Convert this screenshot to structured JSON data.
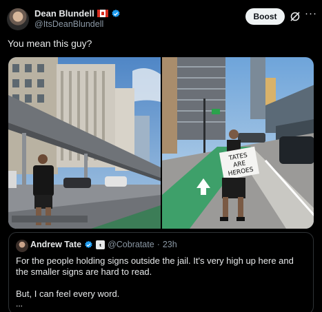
{
  "post": {
    "author": {
      "display_name": "Dean Blundell",
      "handle": "@ItsDeanBlundell",
      "flag_icon": "canada-flag-icon",
      "verified_color": "#1d9bf0"
    },
    "boost_label": "Boost",
    "more_label": "···",
    "text": "You mean this guy?"
  },
  "media": {
    "photo2_sign": [
      "TATES",
      "ARE",
      "HEROES"
    ]
  },
  "quote": {
    "author": {
      "display_name": "Andrew Tate",
      "handle": "@Cobratate",
      "affiliate_badge": "ₜ"
    },
    "separator": "·",
    "time": "23h",
    "paragraphs": [
      "For the people holding signs outside the jail. It's very high up here and the smaller signs are hard to read.",
      "But, I can feel every word."
    ],
    "ellipsis": "..."
  },
  "colors": {
    "background": "#000000",
    "text": "#e7e9ea",
    "secondary": "#8b98a5",
    "verified": "#1d9bf0",
    "border": "#2f3336"
  }
}
